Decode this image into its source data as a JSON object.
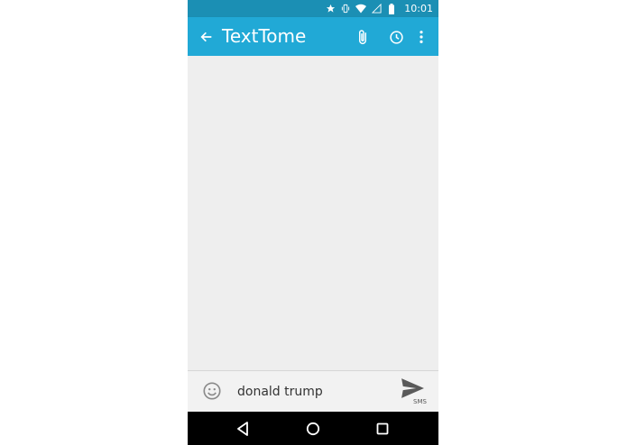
{
  "status_bar": {
    "time": "10:01",
    "icons": [
      "star-icon",
      "vibrate-icon",
      "wifi-icon",
      "signal-icon",
      "battery-icon"
    ]
  },
  "app_bar": {
    "title": "TextTome",
    "back_icon": "arrow-left-icon",
    "actions": [
      "paperclip-icon",
      "clock-icon",
      "more-vert-icon"
    ]
  },
  "compose": {
    "input_value": "donald trump",
    "emoji_icon": "smiley-icon",
    "send_icon": "send-icon",
    "send_label": "SMS"
  },
  "nav_bar": {
    "buttons": [
      "back-triangle-icon",
      "home-circle-icon",
      "recents-square-icon"
    ]
  },
  "colors": {
    "status_bar": "#1b8fb4",
    "app_bar": "#21a9d6",
    "content_bg": "#eeeeee",
    "nav_bar": "#000000"
  }
}
